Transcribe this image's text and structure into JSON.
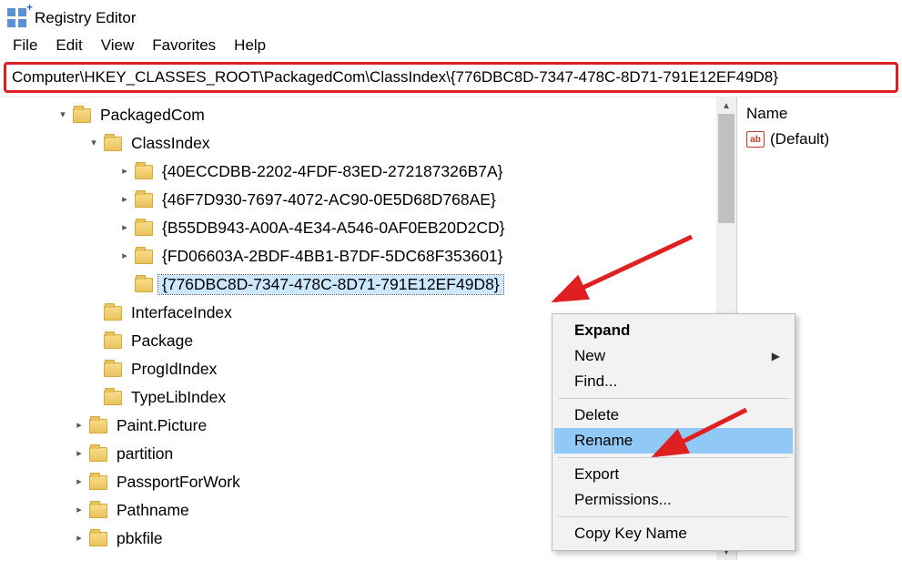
{
  "app": {
    "title": "Registry Editor"
  },
  "menu": {
    "file": "File",
    "edit": "Edit",
    "view": "View",
    "favorites": "Favorites",
    "help": "Help"
  },
  "address": {
    "value": "Computer\\HKEY_CLASSES_ROOT\\PackagedCom\\ClassIndex\\{776DBC8D-7347-478C-8D71-791E12EF49D8}"
  },
  "tree": {
    "packagedcom": "PackagedCom",
    "classindex": "ClassIndex",
    "guids": [
      "{40ECCDBB-2202-4FDF-83ED-272187326B7A}",
      "{46F7D930-7697-4072-AC90-0E5D68D768AE}",
      "{B55DB943-A00A-4E34-A546-0AF0EB20D2CD}",
      "{FD06603A-2BDF-4BB1-B7DF-5DC68F353601}",
      "{776DBC8D-7347-478C-8D71-791E12EF49D8}"
    ],
    "siblings": [
      "InterfaceIndex",
      "Package",
      "ProgIdIndex",
      "TypeLibIndex"
    ],
    "after": [
      "Paint.Picture",
      "partition",
      "PassportForWork",
      "Pathname",
      "pbkfile"
    ]
  },
  "rightpane": {
    "header": "Name",
    "default_value": "(Default)"
  },
  "context": {
    "expand": "Expand",
    "new": "New",
    "find": "Find...",
    "delete": "Delete",
    "rename": "Rename",
    "export": "Export",
    "permissions": "Permissions...",
    "copykey": "Copy Key Name"
  }
}
